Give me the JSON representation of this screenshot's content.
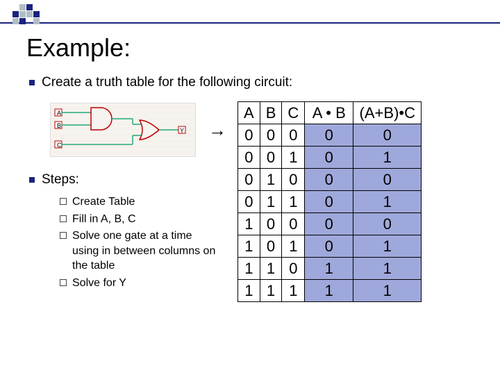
{
  "title": "Example:",
  "subtitle": "Create a truth table for the following circuit:",
  "arrow": "→",
  "steps_header": "Steps:",
  "steps": [
    "Create Table",
    "Fill in A, B, C",
    "Solve one gate at a time using in between columns on the table",
    "Solve for Y"
  ],
  "circuit": {
    "inputs": [
      "A",
      "B",
      "C"
    ],
    "output": "Y"
  },
  "table": {
    "headers": [
      "A",
      "B",
      "C",
      "A • B",
      "(A+B)•C"
    ],
    "rows": [
      [
        "0",
        "0",
        "0",
        "0",
        "0"
      ],
      [
        "0",
        "0",
        "1",
        "0",
        "1"
      ],
      [
        "0",
        "1",
        "0",
        "0",
        "0"
      ],
      [
        "0",
        "1",
        "1",
        "0",
        "1"
      ],
      [
        "1",
        "0",
        "0",
        "0",
        "0"
      ],
      [
        "1",
        "0",
        "1",
        "0",
        "1"
      ],
      [
        "1",
        "1",
        "0",
        "1",
        "1"
      ],
      [
        "1",
        "1",
        "1",
        "1",
        "1"
      ]
    ]
  },
  "chart_data": {
    "type": "table",
    "title": "Truth table for Y = (A+B)·C with intermediate A·B",
    "columns": [
      "A",
      "B",
      "C",
      "A·B",
      "(A+B)·C"
    ],
    "rows": [
      [
        0,
        0,
        0,
        0,
        0
      ],
      [
        0,
        0,
        1,
        0,
        1
      ],
      [
        0,
        1,
        0,
        0,
        0
      ],
      [
        0,
        1,
        1,
        0,
        1
      ],
      [
        1,
        0,
        0,
        0,
        0
      ],
      [
        1,
        0,
        1,
        0,
        1
      ],
      [
        1,
        1,
        0,
        1,
        1
      ],
      [
        1,
        1,
        1,
        1,
        1
      ]
    ]
  }
}
